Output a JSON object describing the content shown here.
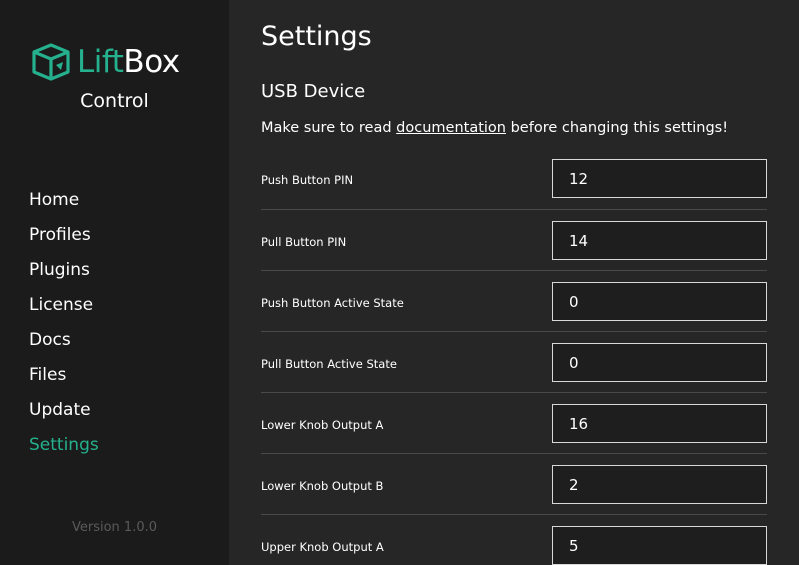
{
  "sidebar": {
    "logo": {
      "part1": "Lift",
      "part2": "Box",
      "subtitle": "Control",
      "accent": "#25b08e"
    },
    "nav": [
      {
        "label": "Home",
        "active": false
      },
      {
        "label": "Profiles",
        "active": false
      },
      {
        "label": "Plugins",
        "active": false
      },
      {
        "label": "License",
        "active": false
      },
      {
        "label": "Docs",
        "active": false
      },
      {
        "label": "Files",
        "active": false
      },
      {
        "label": "Update",
        "active": false
      },
      {
        "label": "Settings",
        "active": true
      }
    ],
    "version": "Version 1.0.0"
  },
  "main": {
    "title": "Settings",
    "section": "USB Device",
    "note": {
      "before": "Make sure to read ",
      "link": "documentation",
      "after": " before changing this settings!"
    },
    "settings": [
      {
        "label": "Push Button PIN",
        "value": "12"
      },
      {
        "label": "Pull Button PIN",
        "value": "14"
      },
      {
        "label": "Push Button Active State",
        "value": "0"
      },
      {
        "label": "Pull Button Active State",
        "value": "0"
      },
      {
        "label": "Lower Knob Output A",
        "value": "16"
      },
      {
        "label": "Lower Knob Output B",
        "value": "2"
      },
      {
        "label": "Upper Knob Output A",
        "value": "5"
      }
    ]
  },
  "colors": {
    "accent": "#25b08e",
    "sidebar_bg": "#1b1b1b",
    "main_bg": "#262626"
  }
}
